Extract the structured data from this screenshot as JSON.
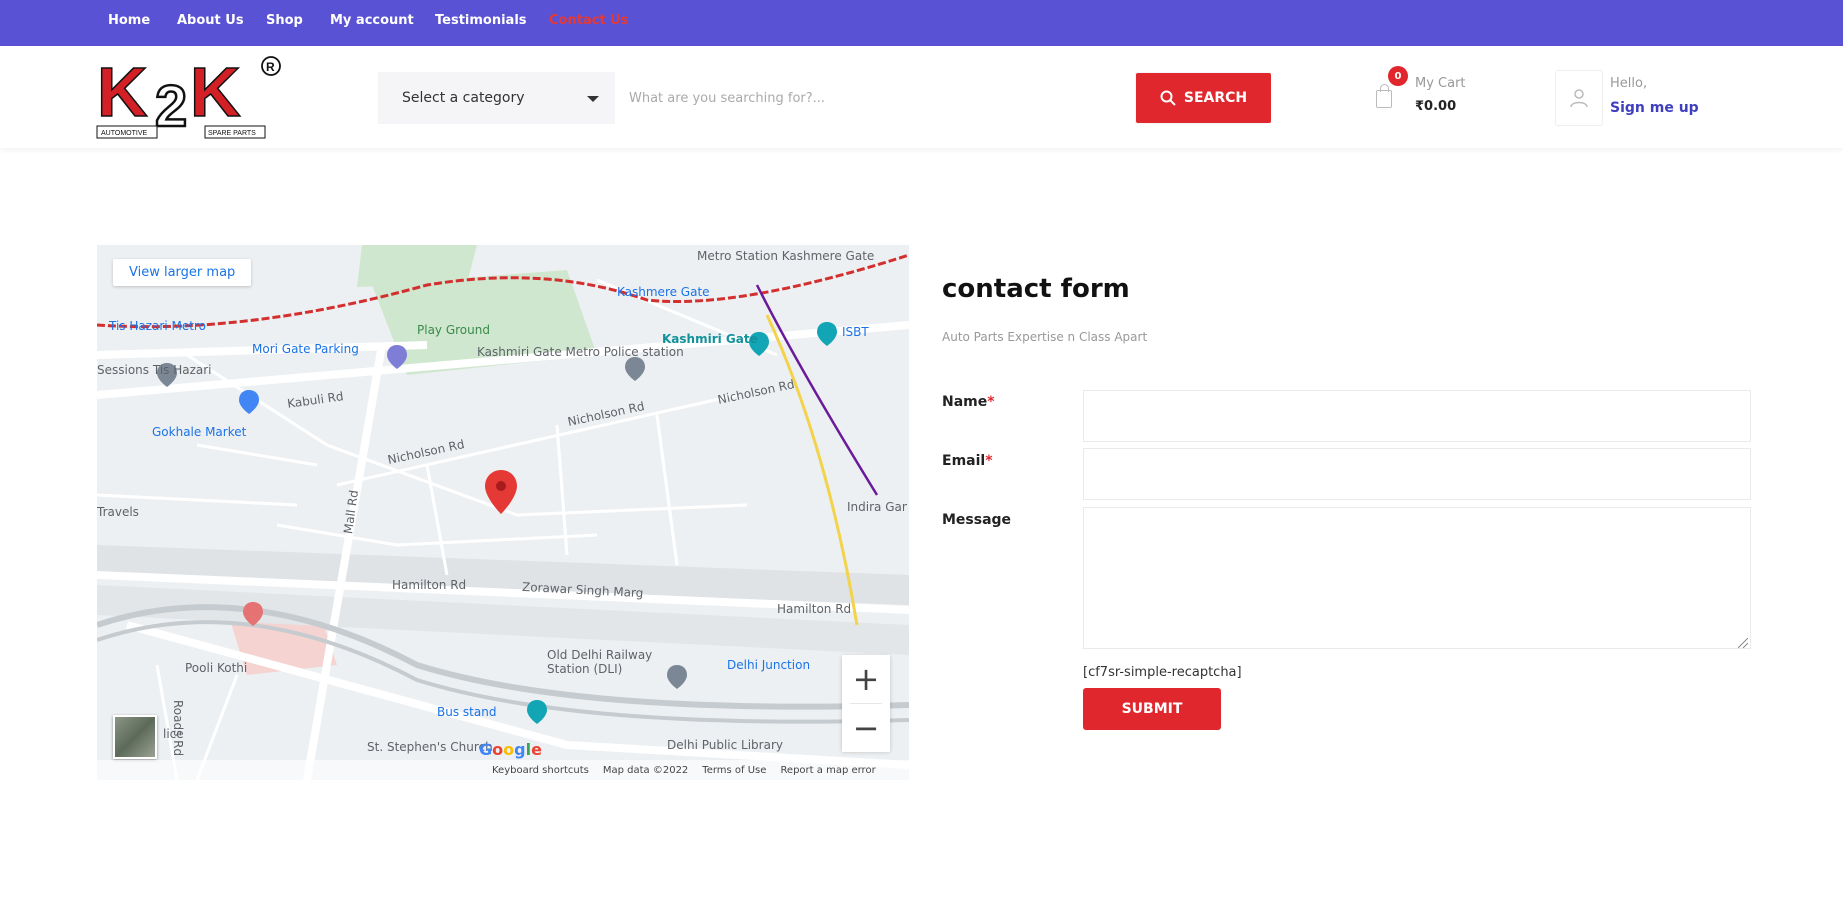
{
  "nav": {
    "items": [
      "Home",
      "About Us",
      "Shop",
      "My account",
      "Testimonials",
      "Contact Us"
    ],
    "active_index": 5
  },
  "logo": {
    "text": "K2K",
    "registered": "®",
    "sub_left": "AUTOMOTIVE",
    "sub_right": "SPARE PARTS"
  },
  "search": {
    "category_label": "Select a category",
    "placeholder": "What are you searching for?...",
    "button_label": "SEARCH"
  },
  "cart": {
    "count": "0",
    "label": "My Cart",
    "amount": "₹0.00"
  },
  "user": {
    "greeting": "Hello,",
    "link": "Sign me up"
  },
  "map": {
    "larger_map_link": "View larger map",
    "labels": {
      "metro_kashmere": "Metro Station Kashmere Gate",
      "kashmere_gate": "Kashmere Gate",
      "kashmiri_gate": "Kashmiri Gate",
      "isbt": "ISBT",
      "hazari_metro": "Tis Hazari Metro",
      "play_ground": "Play Ground",
      "kashmiri_police": "Kashmiri Gate Metro Police station",
      "mori_gate": "Mori Gate Parking",
      "sessions": "Sessions Tis Hazari",
      "kabul": "Kabuli Rd",
      "gokhale": "Gokhale Market",
      "nicholson1": "Nicholson Rd",
      "nicholson2": "Nicholson Rd",
      "nicholson3": "Nicholson Rd",
      "mall_rd": "Mall Rd",
      "travels": "Travels",
      "indira": "Indira Gandhi Delhi Tech",
      "hamilton1": "Hamilton Rd",
      "zorawar": "Zorawar Singh Marg",
      "hamilton2": "Hamilton Rd",
      "old_delhi": "Old Delhi Railway Station (DLI)",
      "delhi_junction": "Delhi Junction",
      "pooli_kothi": "Pooli Kothi",
      "bus_stand": "Bus stand",
      "st_stephens": "St. Stephen's Church",
      "delhi_library": "Delhi Public Library",
      "lice": "lice",
      "road_roads": "Roads Rd"
    },
    "zoom_in": "+",
    "zoom_out": "−",
    "google": "Google",
    "footer": [
      "Keyboard shortcuts",
      "Map data ©2022",
      "Terms of Use",
      "Report a map error"
    ]
  },
  "contact": {
    "title": "contact form",
    "subtitle": "Auto Parts Expertise n Class Apart",
    "name_label": "Name",
    "email_label": "Email",
    "message_label": "Message",
    "required_mark": "*",
    "captcha": "[cf7sr-simple-recaptcha]",
    "submit_label": "SUBMIT"
  },
  "colors": {
    "topbar": "#5952d4",
    "accent_red": "#e0272e",
    "link_blue": "#3f3fbf"
  }
}
